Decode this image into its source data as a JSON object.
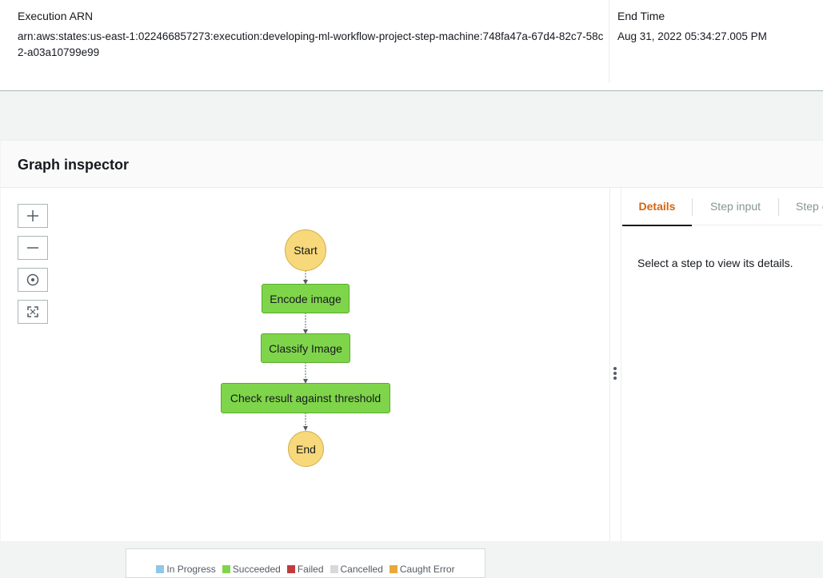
{
  "execution": {
    "arn_label": "Execution ARN",
    "arn_value": "arn:aws:states:us-east-1:022466857273:execution:developing-ml-workflow-project-step-machine:748fa47a-67d4-82c7-58c2-a03a10799e99",
    "end_time_label": "End Time",
    "end_time_value": "Aug 31, 2022 05:34:27.005 PM"
  },
  "inspector": {
    "title": "Graph inspector",
    "zoom_controls": [
      "zoom-in-icon",
      "zoom-out-icon",
      "center-icon",
      "fit-to-screen-icon"
    ],
    "nodes": {
      "start": "Start",
      "encode": "Encode image",
      "classify": "Classify Image",
      "check": "Check result against threshold",
      "end": "End"
    },
    "legend": [
      {
        "label": "In Progress",
        "color": "#8fc7e8"
      },
      {
        "label": "Succeeded",
        "color": "#7fd54a"
      },
      {
        "label": "Failed",
        "color": "#c23a3a"
      },
      {
        "label": "Cancelled",
        "color": "#d9d9d9"
      },
      {
        "label": "Caught Error",
        "color": "#e8a93a"
      }
    ]
  },
  "side_panel": {
    "tabs": {
      "details": "Details",
      "step_input": "Step input",
      "step_output": "Step output"
    },
    "hint": "Select a step to view its details."
  },
  "colors": {
    "accent": "#d5650f",
    "succeeded": "#7fd54a",
    "start_end": "#f7d87a"
  }
}
